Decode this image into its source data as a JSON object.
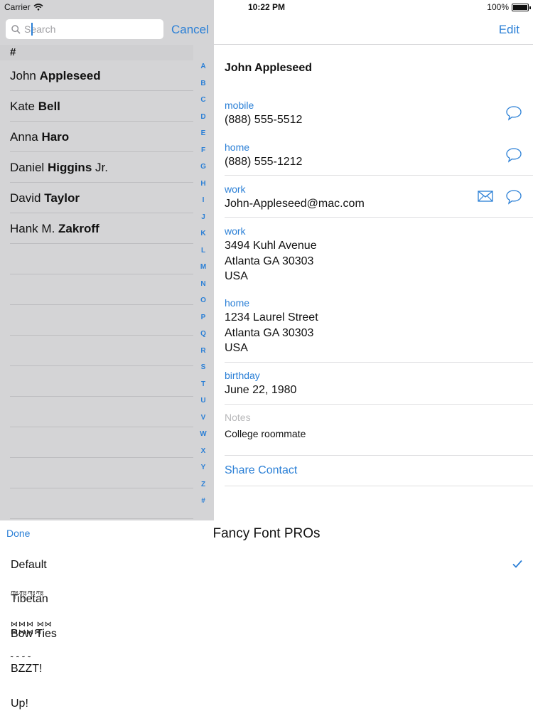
{
  "status_bar": {
    "carrier": "Carrier",
    "time": "10:22 PM",
    "battery": "100%"
  },
  "search": {
    "placeholder": "Search",
    "cancel_label": "Cancel"
  },
  "list": {
    "section": "#",
    "contacts": [
      {
        "first": "John",
        "last": "Appleseed",
        "suffix": ""
      },
      {
        "first": "Kate",
        "last": "Bell",
        "suffix": ""
      },
      {
        "first": "Anna",
        "last": "Haro",
        "suffix": ""
      },
      {
        "first": "Daniel",
        "last": "Higgins",
        "suffix": "Jr."
      },
      {
        "first": "David",
        "last": "Taylor",
        "suffix": ""
      },
      {
        "first": "Hank M.",
        "last": "Zakroff",
        "suffix": ""
      }
    ],
    "index": [
      "A",
      "B",
      "C",
      "D",
      "E",
      "F",
      "G",
      "H",
      "I",
      "J",
      "K",
      "L",
      "M",
      "N",
      "O",
      "P",
      "Q",
      "R",
      "S",
      "T",
      "U",
      "V",
      "W",
      "X",
      "Y",
      "Z",
      "#"
    ]
  },
  "detail": {
    "edit_label": "Edit",
    "name": "John Appleseed",
    "phone_mobile": {
      "label": "mobile",
      "value": "(888) 555-5512"
    },
    "phone_home": {
      "label": "home",
      "value": "(888) 555-1212"
    },
    "email_work": {
      "label": "work",
      "value": "John-Appleseed@mac.com"
    },
    "address_work": {
      "label": "work",
      "line1": "3494 Kuhl Avenue",
      "line2": "Atlanta GA 30303",
      "line3": "USA"
    },
    "address_home": {
      "label": "home",
      "line1": "1234 Laurel Street",
      "line2": "Atlanta GA 30303",
      "line3": "USA"
    },
    "birthday": {
      "label": "birthday",
      "value": "June 22, 1980"
    },
    "notes": {
      "label": "Notes",
      "value": "College roommate"
    },
    "share_label": "Share Contact"
  },
  "picker": {
    "done_label": "Done",
    "title": "Fancy Font PROs",
    "fonts": [
      {
        "label": "Default",
        "selected": true
      },
      {
        "label": "Tibetan",
        "selected": false
      },
      {
        "label": "Bow Ties",
        "selected": false
      },
      {
        "label": "BZZT!",
        "selected": false
      },
      {
        "label": "Up!",
        "selected": false
      }
    ]
  },
  "colors": {
    "accent": "#2a7fd6",
    "sidebar_bg": "#d4d4d6"
  },
  "icons": [
    "wifi-icon",
    "battery-icon",
    "search-icon",
    "message-icon",
    "mail-icon",
    "checkmark-icon"
  ]
}
